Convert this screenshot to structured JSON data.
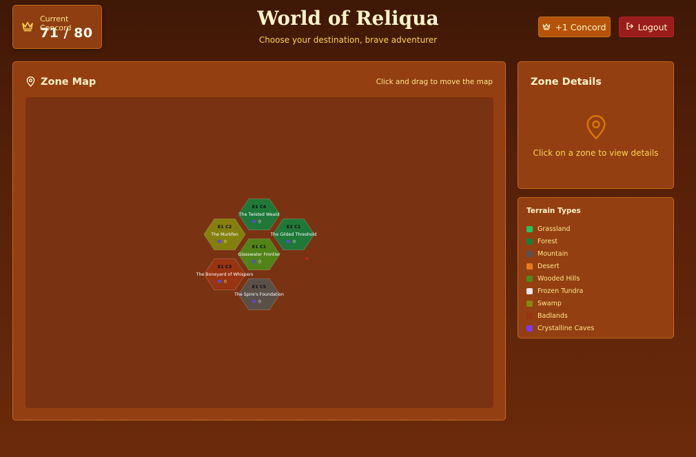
{
  "header": {
    "concord_label": "Current Concord",
    "concord_value": "71 / 80",
    "title": "World of Reliqua",
    "subtitle": "Choose your destination, brave adventurer",
    "add_concord_label": "+1 Concord",
    "logout_label": "Logout"
  },
  "map": {
    "title": "Zone Map",
    "hint": "Click and drag to move the map",
    "zones": [
      {
        "code": "E1 C4",
        "name": "The Twisted Weald",
        "count": "0",
        "terrain": "Forest"
      },
      {
        "code": "E1 C2",
        "name": "The Murkfen",
        "count": "0",
        "terrain": "Swamp"
      },
      {
        "code": "E2 C1",
        "name": "The Gilded Threshold",
        "count": "0",
        "terrain": "Forest"
      },
      {
        "code": "E1 C1",
        "name": "Glasswater Frontier",
        "count": "0",
        "terrain": "Wooded Hills"
      },
      {
        "code": "E1 C3",
        "name": "The Boneyard of Whispers",
        "count": "0",
        "terrain": "Badlands"
      },
      {
        "code": "E1 C5",
        "name": "The Spire's Foundation",
        "count": "0",
        "terrain": "Mountain"
      }
    ]
  },
  "details": {
    "title": "Zone Details",
    "empty_message": "Click on a zone to view details"
  },
  "terrain": {
    "title": "Terrain Types",
    "items": [
      {
        "label": "Grassland",
        "color": "#22c55e"
      },
      {
        "label": "Forest",
        "color": "#15803d"
      },
      {
        "label": "Mountain",
        "color": "#57534e"
      },
      {
        "label": "Desert",
        "color": "#ea7a1c"
      },
      {
        "label": "Wooded Hills",
        "color": "#4d8c1a"
      },
      {
        "label": "Frozen Tundra",
        "color": "#e5e7eb"
      },
      {
        "label": "Swamp",
        "color": "#84880e"
      },
      {
        "label": "Badlands",
        "color": "#9a3412"
      },
      {
        "label": "Crystalline Caves",
        "color": "#7c3aed"
      }
    ]
  },
  "colors": {
    "background": "#552007",
    "panel": "#933f12",
    "panel_border": "#c66a1f",
    "accent": "#b45309",
    "danger": "#9b1c1c",
    "text": "#fde68a"
  },
  "icons": {
    "concord": "crown-icon",
    "logout": "logout-icon",
    "map": "map-pin-icon",
    "details": "map-pin-icon",
    "zone_players": "users-icon"
  }
}
